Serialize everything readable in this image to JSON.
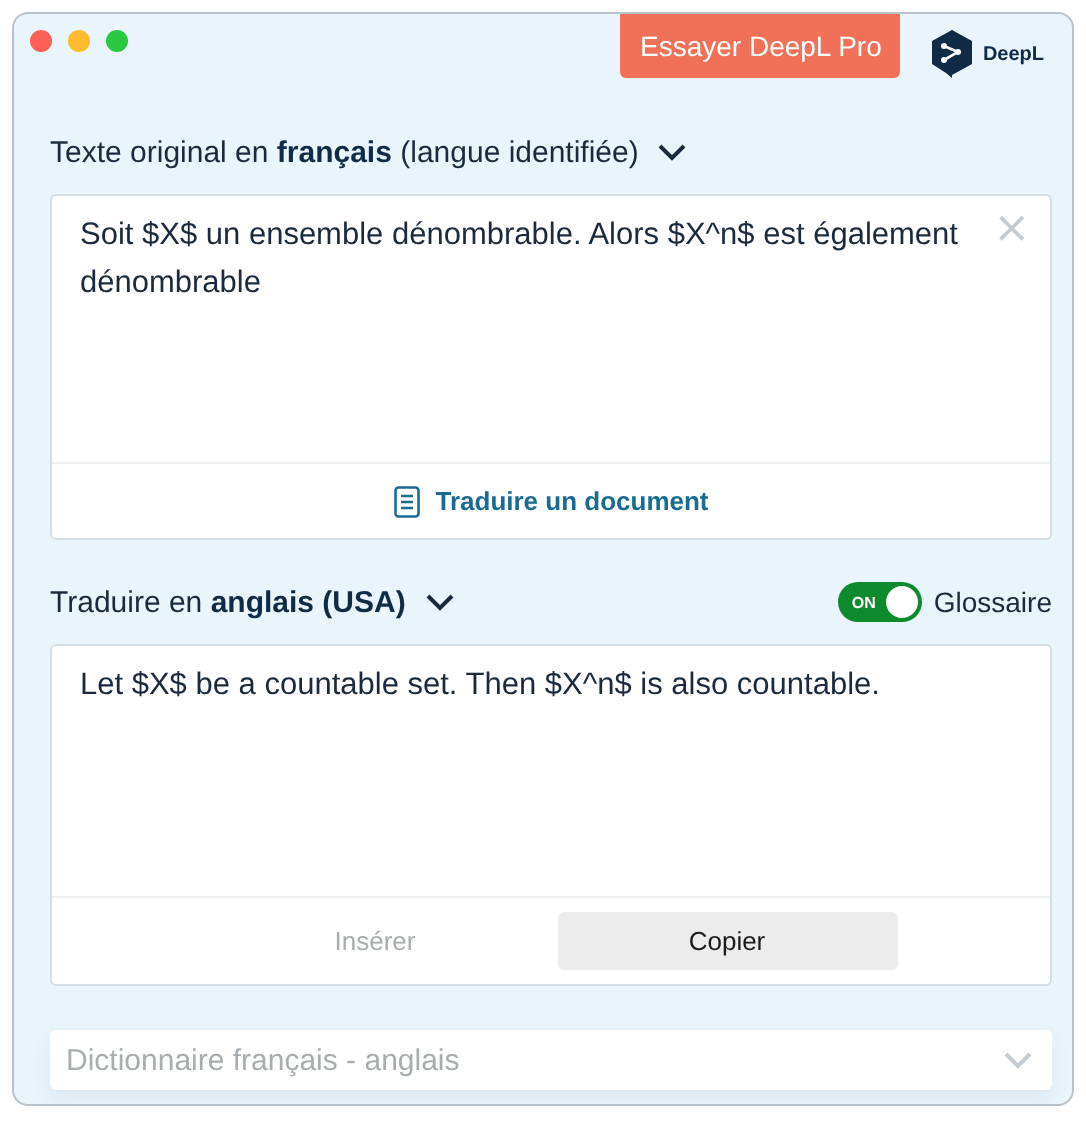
{
  "header": {
    "pro_button": "Essayer DeepL Pro",
    "logo_text": "DeepL"
  },
  "source": {
    "label": "Texte original en **français** (langue identifiée)",
    "text": "Soit $X$ un ensemble dénombrable. Alors $X^n$ est également dénombrable",
    "close": "×",
    "action": "Traduire un document"
  },
  "target": {
    "label": "Traduire en **anglais (USA)**",
    "glossary": {
      "label": "Glossaire",
      "toggle_text": "ON",
      "on": true
    },
    "text": "Let $X$ be a countable set. Then $X^n$ is also countable.",
    "buttons": [
      {
        "label": "Insérer",
        "disabled": true
      },
      {
        "label": "Copier",
        "disabled": false
      }
    ]
  },
  "dictionary": {
    "placeholder": "Dictionnaire français - anglais"
  }
}
